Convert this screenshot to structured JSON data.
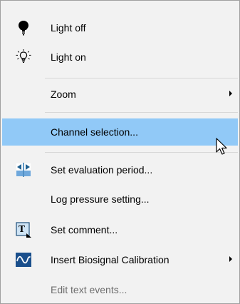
{
  "menu": {
    "items": [
      {
        "label": "Light off",
        "icon": "lightbulb-filled-icon"
      },
      {
        "label": "Light on",
        "icon": "lightbulb-glowing-icon"
      },
      {
        "label": "Zoom",
        "submenu": true
      },
      {
        "label": "Channel selection...",
        "highlighted": true
      },
      {
        "label": "Set evaluation period...",
        "icon": "evaluation-period-icon"
      },
      {
        "label": "Log pressure setting..."
      },
      {
        "label": "Set comment...",
        "icon": "comment-text-icon"
      },
      {
        "label": "Insert Biosignal Calibration",
        "icon": "sine-wave-icon",
        "submenu": true
      },
      {
        "label": "Edit text events...",
        "disabled": true
      }
    ]
  },
  "colors": {
    "menu_background": "#f2f2f2",
    "highlight": "#91c9f7",
    "separator": "#d7d7d7",
    "text": "#000000",
    "disabled_text": "#6d6d6d",
    "icon_blue": "#1f6fae"
  }
}
